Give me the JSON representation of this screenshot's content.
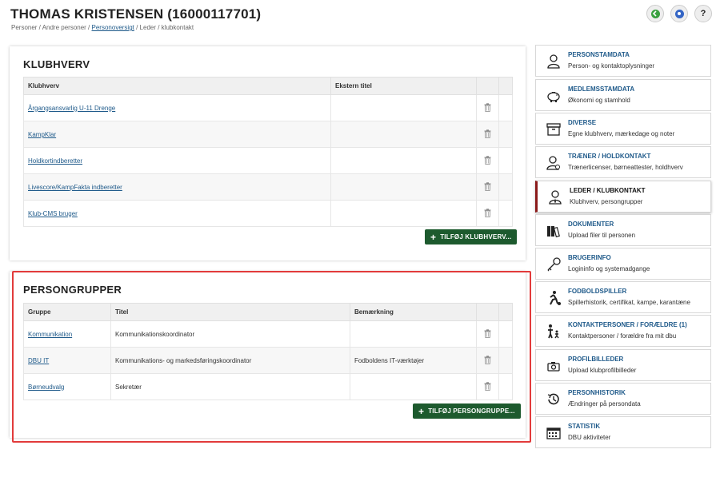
{
  "header": {
    "title": "THOMAS KRISTENSEN (16000117701)",
    "breadcrumb": {
      "part1": "Personer / Andre personer /",
      "link": "Personoversigt",
      "part2": "/ Leder / klubkontakt"
    },
    "help_label": "?"
  },
  "klubhverv": {
    "title": "KLUBHVERV",
    "columns": [
      "Klubhverv",
      "Ekstern titel"
    ],
    "rows": [
      {
        "name": "Årgangsansvarlig U-11 Drenge",
        "ext": ""
      },
      {
        "name": "KampKlar",
        "ext": ""
      },
      {
        "name": "Holdkortindberetter",
        "ext": ""
      },
      {
        "name": "Livescore/KampFakta indberetter",
        "ext": ""
      },
      {
        "name": "Klub-CMS bruger",
        "ext": ""
      }
    ],
    "add_label": "TILFØJ KLUBHVERV..."
  },
  "persongrupper": {
    "title": "PERSONGRUPPER",
    "columns": [
      "Gruppe",
      "Titel",
      "Bemærkning"
    ],
    "rows": [
      {
        "group": "Kommunikation",
        "title": "Kommunikationskoordinator",
        "note": ""
      },
      {
        "group": "DBU IT",
        "title": "Kommunikations- og markedsføringskoordinator",
        "note": "Fodboldens IT-værktøjer"
      },
      {
        "group": "Børneudvalg",
        "title": "Sekretær",
        "note": ""
      }
    ],
    "add_label": "TILFØJ PERSONGRUPPE..."
  },
  "sidebar": {
    "items": [
      {
        "icon": "person-icon",
        "title": "PERSONSTAMDATA",
        "sub": "Person- og kontaktoplysninger"
      },
      {
        "icon": "piggy-bank-icon",
        "title": "MEDLEMSSTAMDATA",
        "sub": "Økonomi og stamhold"
      },
      {
        "icon": "archive-box-icon",
        "title": "DIVERSE",
        "sub": "Egne klubhverv, mærkedage og noter"
      },
      {
        "icon": "coach-icon",
        "title": "TRÆNER / HOLDKONTAKT",
        "sub": "Trænerlicenser, børneattester, holdhverv"
      },
      {
        "icon": "leader-icon",
        "title": "LEDER / KLUBKONTAKT",
        "sub": "Klubhverv, persongrupper"
      },
      {
        "icon": "binders-icon",
        "title": "DOKUMENTER",
        "sub": "Upload filer til personen"
      },
      {
        "icon": "key-icon",
        "title": "BRUGERINFO",
        "sub": "Logininfo og systemadgange"
      },
      {
        "icon": "football-player-icon",
        "title": "FODBOLDSPILLER",
        "sub": "Spillerhistorik, certifikat, kampe, karantæne"
      },
      {
        "icon": "parent-child-icon",
        "title": "KONTAKTPERSONER / FORÆLDRE (1)",
        "sub": "Kontaktpersoner / forældre fra mit dbu"
      },
      {
        "icon": "camera-icon",
        "title": "PROFILBILLEDER",
        "sub": "Upload klubprofilbilleder"
      },
      {
        "icon": "history-icon",
        "title": "PERSONHISTORIK",
        "sub": "Ændringer på persondata"
      },
      {
        "icon": "calendar-icon",
        "title": "STATISTIK",
        "sub": "DBU aktiviteter"
      }
    ]
  },
  "colors": {
    "accent_green": "#1d5a2e",
    "link_blue": "#1f5a8a",
    "active_marker": "#8b1a1a",
    "highlight_red": "#e23b3b"
  }
}
